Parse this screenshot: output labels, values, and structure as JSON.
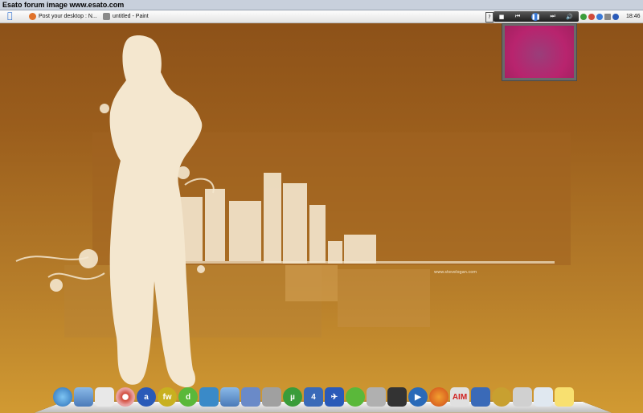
{
  "window": {
    "title": "Esato forum image www.esato.com"
  },
  "taskbar": {
    "tasks": [
      {
        "label": "Post your desktop : N...",
        "icon": "firefox-icon"
      },
      {
        "label": "untitled - Paint",
        "icon": "paint-icon"
      }
    ],
    "clock": "18:46"
  },
  "media_player": {
    "controls": [
      "stop-icon",
      "prev-icon",
      "play-pause-icon",
      "next-icon",
      "volume-icon"
    ]
  },
  "wallpaper": {
    "watermark": "www.stevelogan.com"
  },
  "dock": {
    "items": [
      "globe-icon",
      "folder-icon",
      "document-icon",
      "cd-icon",
      "amazon-icon",
      "flash-icon",
      "dreamweaver-icon",
      "messenger-icon",
      "folder-icon",
      "finder-icon",
      "tools-icon",
      "utorrent-icon",
      "channel4-icon",
      "plane-icon",
      "cog-icon",
      "bug-icon",
      "terminal-icon",
      "media-play-icon",
      "firefox-icon",
      "aim-icon",
      "network-icon",
      "settings-icon",
      "hammer-icon",
      "recycle-bin-icon",
      "notes-icon"
    ]
  },
  "colors": {
    "desktop_top": "#8a4f18",
    "desktop_bottom": "#d19a32",
    "art": "#f4e7cf"
  }
}
